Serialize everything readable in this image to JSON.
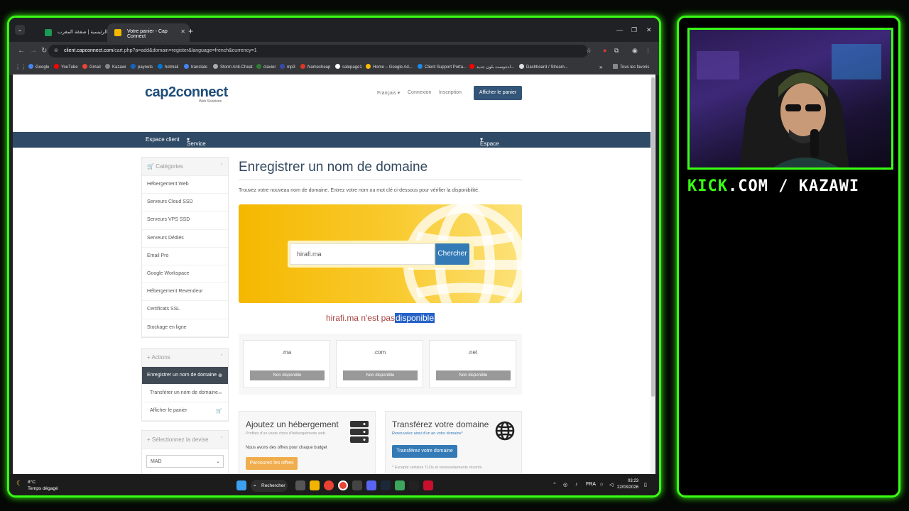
{
  "browser": {
    "tabs": [
      {
        "label": "الرئيسية | صفقة المغرب",
        "active": false
      },
      {
        "label": "Votre panier - Cap Connect",
        "active": true
      }
    ],
    "url_host": "client.capconnect.com",
    "url_path": "/cart.php?a=add&domain=register&language=french&currency=1",
    "bookmarks": [
      "Google",
      "YouTube",
      "Gmail",
      "Kazawi",
      "payouts",
      "hotmail",
      "translate",
      "Storm Anti-Cheat",
      "clavier",
      "mp3",
      "Namecheap",
      "salepage1",
      "Home – Google Ad...",
      "Client Support Porta...",
      "ادجوست بلون جديد...",
      "Dashboard / Stream..."
    ],
    "all_bookmarks": "Tous les favoris"
  },
  "site": {
    "logo_text": "cap2connect",
    "logo_sub": "Web Solutions",
    "top_links": {
      "language": "Français",
      "login": "Connexion",
      "register": "Inscription"
    },
    "cart_button": "Afficher le panier",
    "nav": {
      "client_area": "Espace client",
      "service": "Service",
      "right_menu": "Espace client"
    }
  },
  "sidebar": {
    "categories_title": "Catégories",
    "categories": [
      "Hébergement Web",
      "Serveurs Cloud SSD",
      "Serveurs VPS SSD",
      "Serveurs Dédiés",
      "Email Pro",
      "Google Workspace",
      "Hébergement Revendeur",
      "Certificats SSL",
      "Stockage en ligne"
    ],
    "actions_title": "Actions",
    "actions": [
      "Enregistrer un nom de domaine",
      "Transférer un nom de domaine",
      "Afficher le panier"
    ],
    "currency_title": "Sélectionnez la devise",
    "currency_value": "MAD"
  },
  "main": {
    "title": "Enregistrer un nom de domaine",
    "intro": "Trouvez votre nouveau nom de domaine. Entrez votre nom ou mot clé ci-dessous pour vérifier la disponibilité.",
    "search_value": "hirafi.ma",
    "search_button": "Chercher",
    "result_domain": "hirafi.ma",
    "result_text": "n'est pas",
    "result_highlight": "disponible",
    "tlds": [
      {
        "tld": ".ma",
        "status": "Non disponible"
      },
      {
        "tld": ".com",
        "status": "Non disponible"
      },
      {
        "tld": ".net",
        "status": "Non disponible"
      }
    ],
    "hosting_promo": {
      "title": "Ajoutez un hébergement",
      "subtitle": "Profitez d'un vaste choix d'hébergements web",
      "text": "Nous avons des offres pour chaque budget",
      "button": "Parcourez les offres",
      "button_color": "#f0ad4e"
    },
    "transfer_promo": {
      "title": "Transférez votre domaine",
      "subtitle": "Renouvelez ainsi d'un an votre domaine*",
      "button": "Transférez votre domaine",
      "note": "* Excepté certains TLDs et renouvellements récents",
      "button_color": "#337ab7"
    }
  },
  "taskbar": {
    "temperature": "8°C",
    "weather": "Temps dégagé",
    "search": "Rechercher",
    "lang": "FRA",
    "time": "03:23",
    "date": "22/03/2026"
  },
  "overlay": {
    "kick_green": "KICK",
    "kick_white": ".COM / KAZAWI",
    "accent": "#39ff14"
  }
}
